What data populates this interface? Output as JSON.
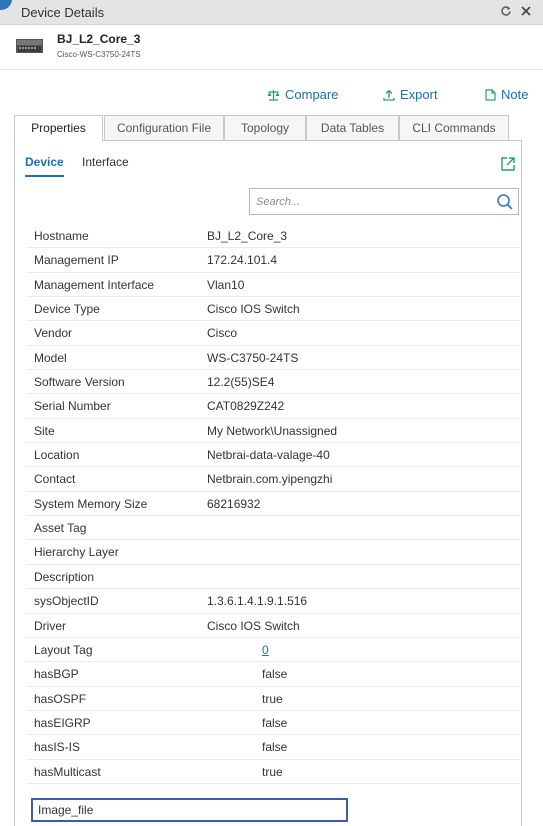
{
  "window": {
    "title": "Device Details"
  },
  "device": {
    "name": "BJ_L2_Core_3",
    "model": "Cisco-WS-C3750-24TS"
  },
  "actions": {
    "compare": "Compare",
    "export": "Export",
    "note": "Note"
  },
  "tabs": [
    {
      "label": "Properties"
    },
    {
      "label": "Configuration File"
    },
    {
      "label": "Topology"
    },
    {
      "label": "Data Tables"
    },
    {
      "label": "CLI Commands"
    }
  ],
  "subtabs": {
    "device": "Device",
    "interface": "Interface"
  },
  "search": {
    "placeholder": "Search..."
  },
  "properties": [
    {
      "key": "Hostname",
      "value": "BJ_L2_Core_3"
    },
    {
      "key": "Management IP",
      "value": "172.24.101.4"
    },
    {
      "key": "Management Interface",
      "value": "Vlan10"
    },
    {
      "key": "Device Type",
      "value": "Cisco IOS Switch"
    },
    {
      "key": "Vendor",
      "value": "Cisco"
    },
    {
      "key": "Model",
      "value": "WS-C3750-24TS"
    },
    {
      "key": "Software Version",
      "value": "12.2(55)SE4"
    },
    {
      "key": "Serial Number",
      "value": "CAT0829Z242"
    },
    {
      "key": "Site",
      "value": "My Network\\Unassigned"
    },
    {
      "key": "Location",
      "value": "Netbrai-data-valage-40"
    },
    {
      "key": "Contact",
      "value": "Netbrain.com.yipengzhi"
    },
    {
      "key": "System Memory Size",
      "value": "68216932"
    },
    {
      "key": "Asset Tag",
      "value": ""
    },
    {
      "key": "Hierarchy Layer",
      "value": ""
    },
    {
      "key": "Description",
      "value": ""
    },
    {
      "key": "sysObjectID",
      "value": "1.3.6.1.4.1.9.1.516"
    },
    {
      "key": "Driver",
      "value": "Cisco IOS Switch"
    },
    {
      "key": "Layout Tag",
      "value": "0"
    },
    {
      "key": "hasBGP",
      "value": "false"
    },
    {
      "key": "hasOSPF",
      "value": "true"
    },
    {
      "key": "hasEIGRP",
      "value": "false"
    },
    {
      "key": "hasIS-IS",
      "value": "false"
    },
    {
      "key": "hasMulticast",
      "value": "true"
    }
  ],
  "highlighted_field": {
    "label": "Image_file"
  },
  "colors": {
    "accent": "#1a6fb5",
    "icon_green": "#2a9d6f",
    "highlight_border": "#3a5fa8"
  },
  "icons": {
    "refresh": "refresh-icon",
    "close": "close-icon",
    "compare": "scale-icon",
    "export": "upload-icon",
    "note": "note-icon",
    "popout": "popout-icon",
    "search": "search-icon"
  }
}
